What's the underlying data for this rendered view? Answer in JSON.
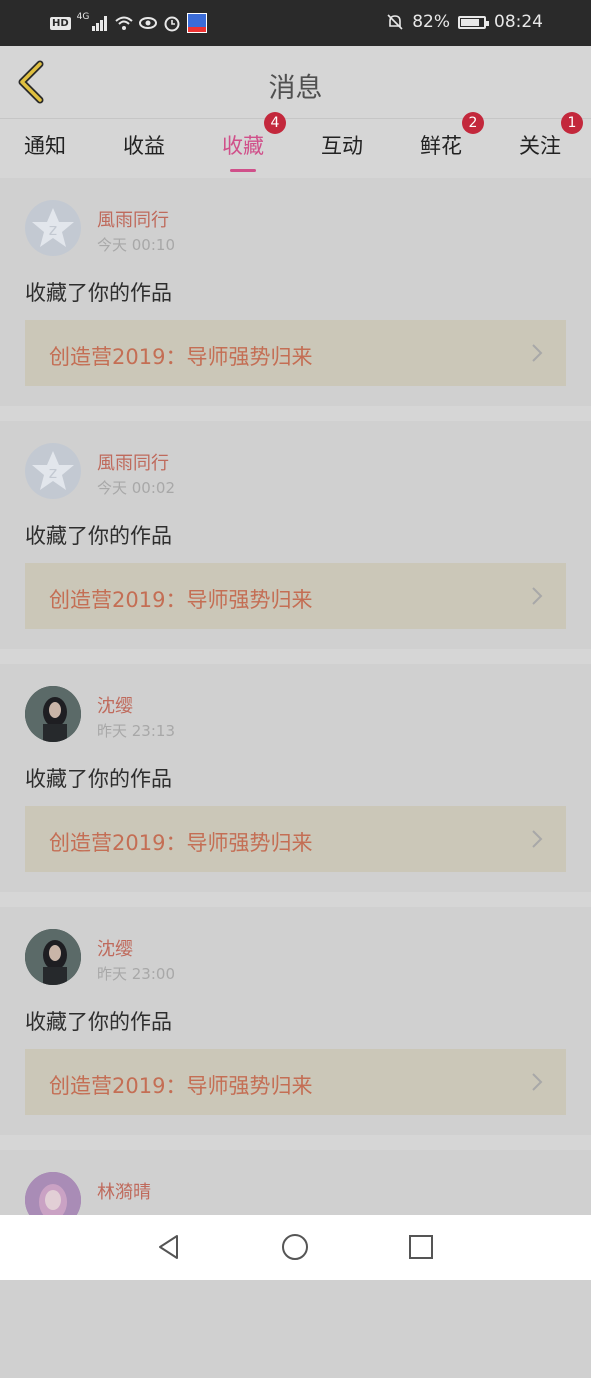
{
  "status_bar": {
    "hd": "HD",
    "network": "4G",
    "battery_pct": "82%",
    "battery_level": 0.82,
    "time": "08:24"
  },
  "header": {
    "title": "消息"
  },
  "tabs": [
    {
      "label": "通知",
      "badge": ""
    },
    {
      "label": "收益",
      "badge": ""
    },
    {
      "label": "收藏",
      "badge": "4"
    },
    {
      "label": "互动",
      "badge": ""
    },
    {
      "label": "鲜花",
      "badge": "2"
    },
    {
      "label": "关注",
      "badge": "1"
    }
  ],
  "active_tab": "收藏",
  "items": [
    {
      "user": "風雨同行",
      "time": "今天 00:10",
      "action": "收藏了你的作品",
      "work": "创造营2019：导师强势归来",
      "avatar": "default-avatar"
    },
    {
      "user": "風雨同行",
      "time": "今天 00:02",
      "action": "收藏了你的作品",
      "work": "创造营2019：导师强势归来",
      "avatar": "default-avatar"
    },
    {
      "user": "沈缨",
      "time": "昨天 23:13",
      "action": "收藏了你的作品",
      "work": "创造营2019：导师强势归来",
      "avatar": "photo-avatar"
    },
    {
      "user": "沈缨",
      "time": "昨天 23:00",
      "action": "收藏了你的作品",
      "work": "创造营2019：导师强势归来",
      "avatar": "photo-avatar"
    },
    {
      "user": "林漪晴",
      "time": "",
      "action": "",
      "work": "",
      "avatar": "photo-avatar"
    }
  ],
  "colors": {
    "accent": "#d0508a",
    "badge": "#c3283c",
    "username": "#bf6a5c",
    "work_title": "#c46e54",
    "back_arrow": "#e0c040"
  }
}
